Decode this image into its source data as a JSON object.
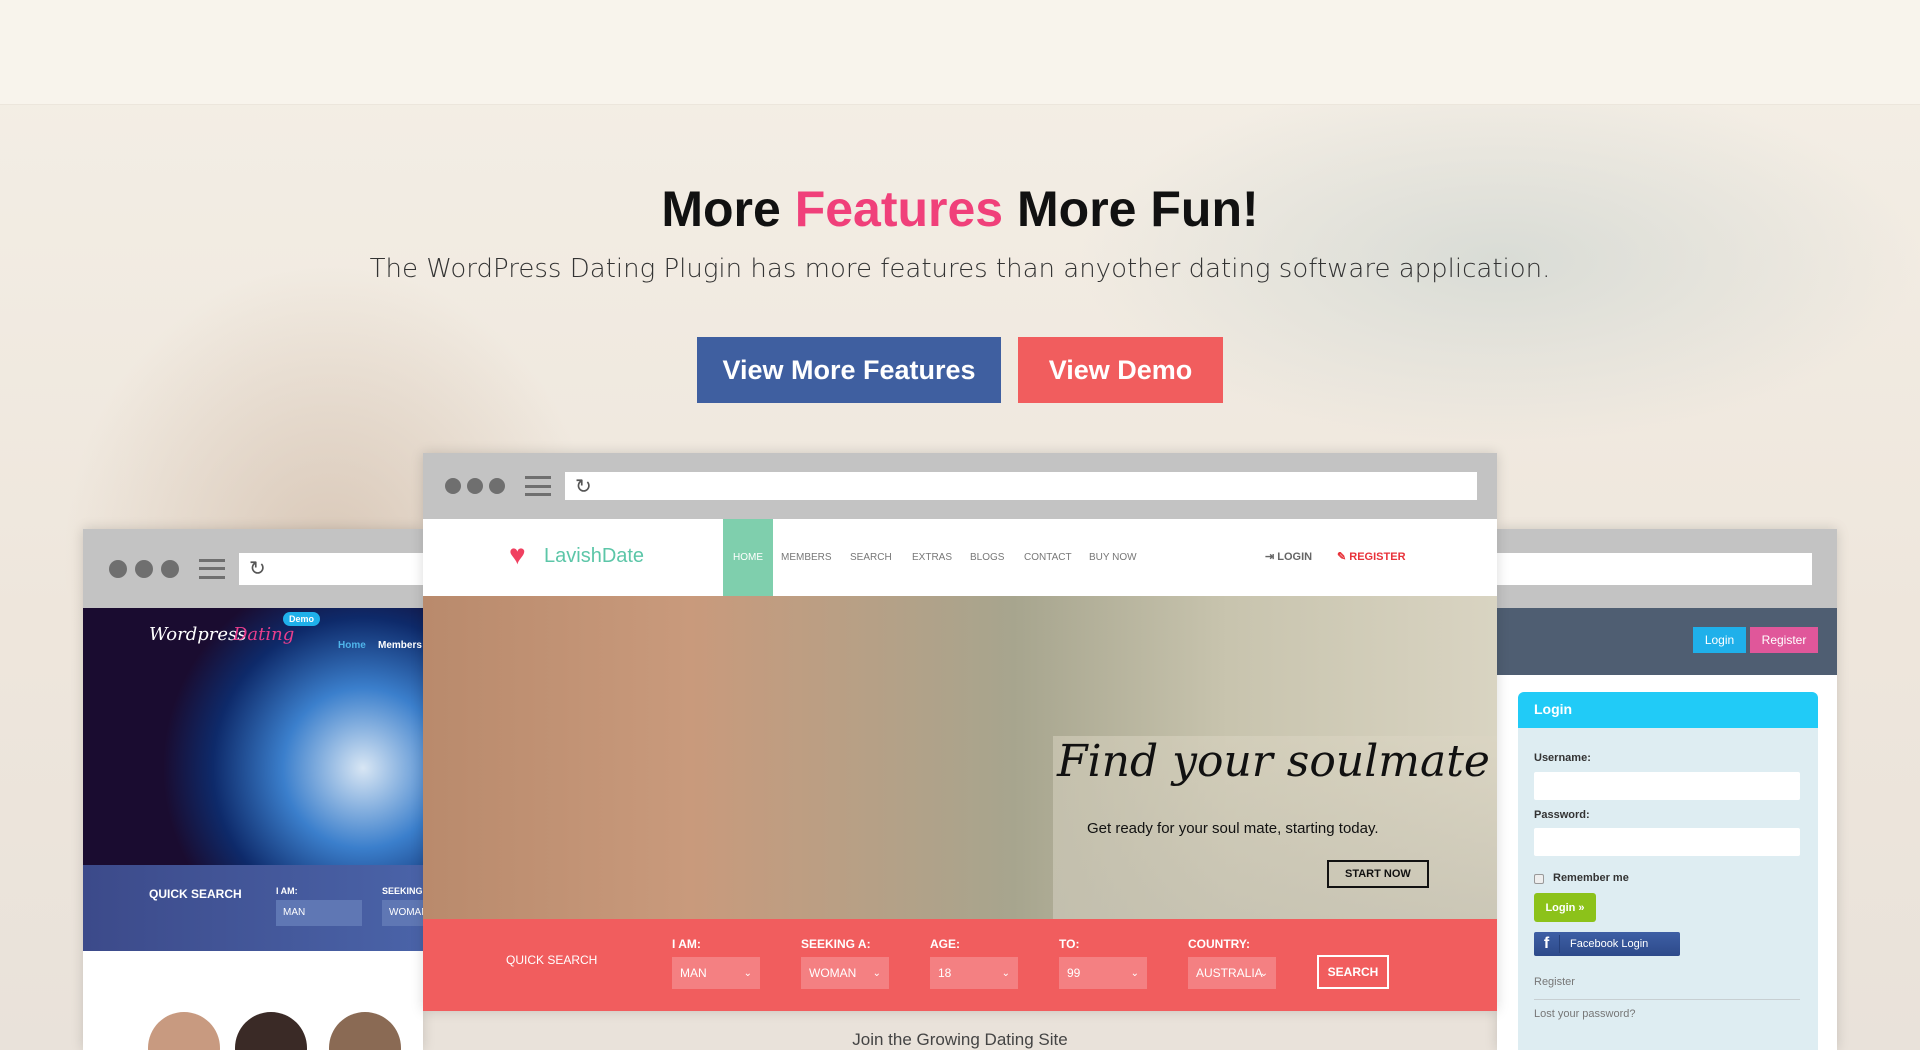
{
  "hero": {
    "title_pre": "More ",
    "title_highlight": "Features",
    "title_post": " More Fun!",
    "subtitle": "The WordPress Dating Plugin has more features than anyother dating software application.",
    "btn_features": "View More Features",
    "btn_demo": "View Demo"
  },
  "left_site": {
    "logo_a": "Wordpress",
    "logo_b": "Dating",
    "badge": "Demo",
    "nav": [
      "Home",
      "Members"
    ],
    "quick_search": "QUICK SEARCH",
    "i_am_label": "I AM:",
    "i_am": "MAN",
    "seeking_label": "SEEKING A:",
    "seeking": "WOMAN"
  },
  "center_site": {
    "logo": "LavishDate",
    "nav": [
      "HOME",
      "MEMBERS",
      "SEARCH",
      "EXTRAS",
      "BLOGS",
      "CONTACT",
      "BUY NOW"
    ],
    "login": "LOGIN",
    "register": "REGISTER",
    "hero_title": "Find your soulmate",
    "hero_sub": "Get ready for your soul mate, starting today.",
    "start_now": "START NOW",
    "search": {
      "title": "QUICK SEARCH",
      "fields": [
        {
          "label": "I AM:",
          "value": "MAN"
        },
        {
          "label": "SEEKING A:",
          "value": "WOMAN"
        },
        {
          "label": "AGE:",
          "value": "18"
        },
        {
          "label": "TO:",
          "value": "99"
        },
        {
          "label": "COUNTRY:",
          "value": "AUSTRALIA"
        }
      ],
      "button": "SEARCH"
    },
    "below": "Join the Growing Dating Site"
  },
  "right_site": {
    "login_btn": "Login",
    "register_btn": "Register",
    "panel_title": "Login",
    "username_label": "Username:",
    "password_label": "Password:",
    "remember": "Remember me",
    "login_submit": "Login »",
    "facebook": "Facebook Login",
    "register_link": "Register",
    "lost_password": "Lost your password?"
  },
  "colors": {
    "accent_pink": "#f0407a",
    "blue_button": "#3f5fa0",
    "coral": "#f15d5e",
    "nav_active": "#7fcfad"
  }
}
